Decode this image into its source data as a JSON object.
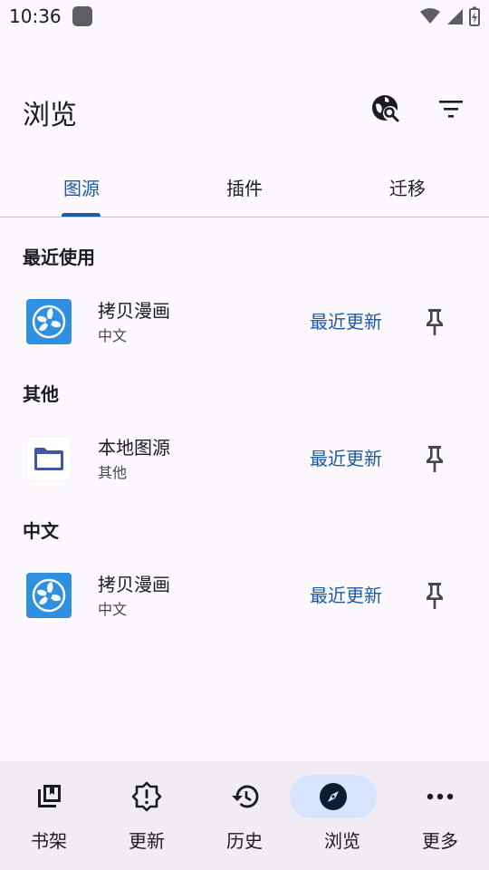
{
  "status": {
    "time": "10:36"
  },
  "header": {
    "title": "浏览"
  },
  "tabs": [
    {
      "label": "图源"
    },
    {
      "label": "插件"
    },
    {
      "label": "迁移"
    }
  ],
  "sections": [
    {
      "title": "最近使用"
    },
    {
      "title": "其他"
    },
    {
      "title": "中文"
    }
  ],
  "sources": [
    {
      "name": "拷贝漫画",
      "lang": "中文",
      "latest": "最近更新",
      "icon": "fan-app-icon"
    },
    {
      "name": "本地图源",
      "lang": "其他",
      "latest": "最近更新",
      "icon": "folder-icon"
    },
    {
      "name": "拷贝漫画",
      "lang": "中文",
      "latest": "最近更新",
      "icon": "fan-app-icon"
    }
  ],
  "nav": [
    {
      "label": "书架",
      "icon": "library-icon"
    },
    {
      "label": "更新",
      "icon": "alert-badge-icon"
    },
    {
      "label": "历史",
      "icon": "history-icon"
    },
    {
      "label": "浏览",
      "icon": "compass-icon"
    },
    {
      "label": "更多",
      "icon": "more-horizontal-icon"
    }
  ],
  "colors": {
    "accent": "#1c5aa6",
    "background": "#fcf8fd",
    "nav_bg": "#f1ecf4",
    "active_pill": "#d7e3ff"
  }
}
